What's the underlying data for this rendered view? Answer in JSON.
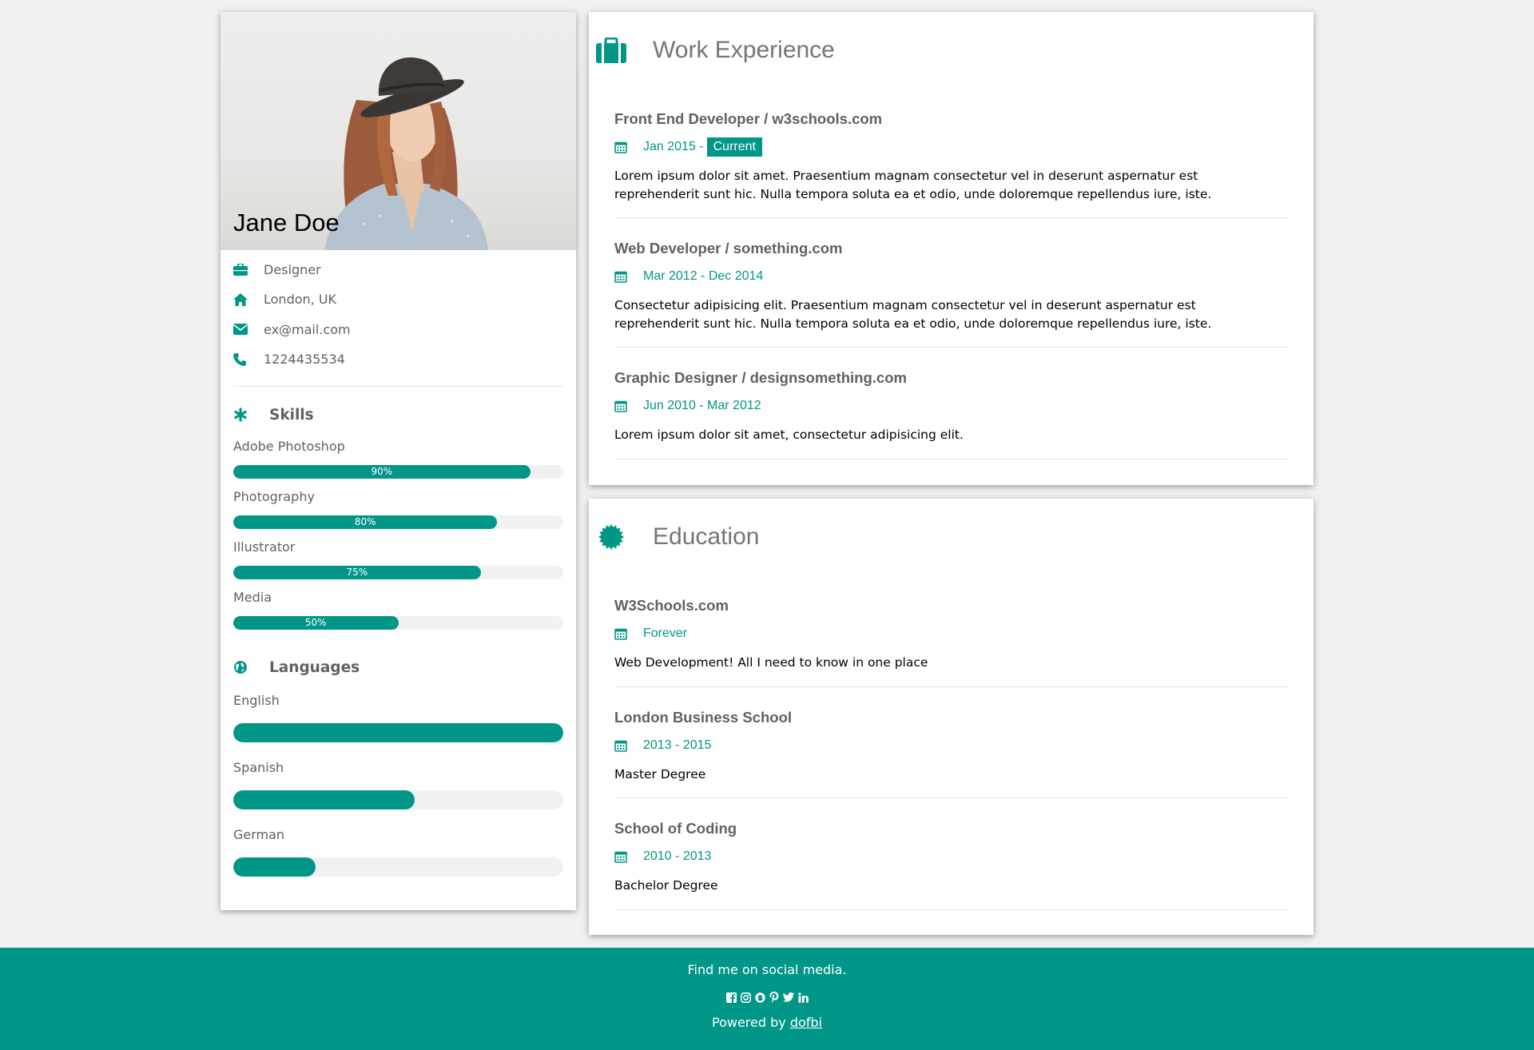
{
  "profile": {
    "name": "Jane Doe",
    "job": "Designer",
    "location": "London, UK",
    "email": "ex@mail.com",
    "phone": "1224435534"
  },
  "skills": {
    "title": "Skills",
    "items": [
      {
        "label": "Adobe Photoshop",
        "percent": 90,
        "text": "90%"
      },
      {
        "label": "Photography",
        "percent": 80,
        "text": "80%"
      },
      {
        "label": "Illustrator",
        "percent": 75,
        "text": "75%"
      },
      {
        "label": "Media",
        "percent": 50,
        "text": "50%"
      }
    ]
  },
  "languages": {
    "title": "Languages",
    "items": [
      {
        "label": "English",
        "percent": 100
      },
      {
        "label": "Spanish",
        "percent": 55
      },
      {
        "label": "German",
        "percent": 25
      }
    ]
  },
  "work": {
    "title": "Work Experience",
    "entries": [
      {
        "title": "Front End Developer / w3schools.com",
        "date": "Jan 2015 -",
        "badge": "Current",
        "text": "Lorem ipsum dolor sit amet. Praesentium magnam consectetur vel in deserunt aspernatur est reprehenderit sunt hic. Nulla tempora soluta ea et odio, unde doloremque repellendus iure, iste."
      },
      {
        "title": "Web Developer / something.com",
        "date": "Mar 2012 - Dec 2014",
        "text": "Consectetur adipisicing elit. Praesentium magnam consectetur vel in deserunt aspernatur est reprehenderit sunt hic. Nulla tempora soluta ea et odio, unde doloremque repellendus iure, iste."
      },
      {
        "title": "Graphic Designer / designsomething.com",
        "date": "Jun 2010 - Mar 2012",
        "text": "Lorem ipsum dolor sit amet, consectetur adipisicing elit."
      }
    ]
  },
  "education": {
    "title": "Education",
    "entries": [
      {
        "title": "W3Schools.com",
        "date": "Forever",
        "text": "Web Development! All I need to know in one place"
      },
      {
        "title": "London Business School",
        "date": "2013 - 2015",
        "text": "Master Degree"
      },
      {
        "title": "School of Coding",
        "date": "2010 - 2013",
        "text": "Bachelor Degree"
      }
    ]
  },
  "footer": {
    "text": "Find me on social media.",
    "powered_prefix": "Powered by",
    "powered_link": "dofbi",
    "social_icons": [
      "facebook-icon",
      "instagram-icon",
      "snapchat-icon",
      "pinterest-icon",
      "twitter-icon",
      "linkedin-icon"
    ]
  },
  "colors": {
    "accent": "#009688",
    "background": "#f1f1f1"
  }
}
